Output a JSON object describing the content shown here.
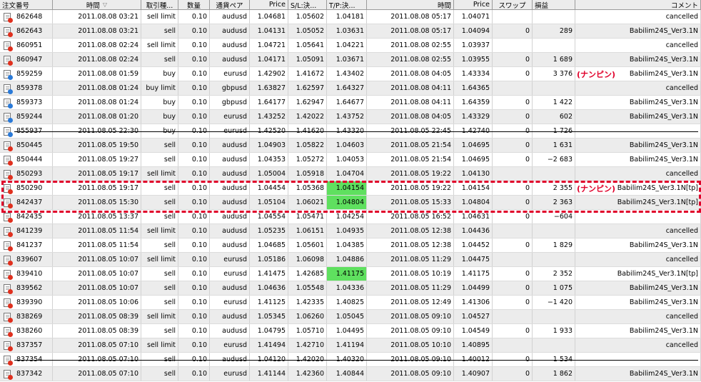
{
  "headers": {
    "order": "注文番号",
    "open_time": "時間",
    "type": "取引種...",
    "size": "数量",
    "symbol": "通貨ペア",
    "open_price": "Price",
    "sl": "S/L:決...",
    "tp": "T/P:決...",
    "close_time": "時間",
    "close_price": "Price",
    "swap": "スワップ",
    "profit": "損益",
    "comment": "コメント"
  },
  "sort_icon": "sort-down-arrow-icon",
  "highlight_color": "#5fe05f",
  "annotation_color": "#e0002a",
  "annotations": {
    "nanpin_1": "(ナンピン)",
    "nanpin_2": "(ナンピン)"
  },
  "rows": [
    {
      "order": "862648",
      "open_time": "2011.08.08 03:21",
      "type": "sell limit",
      "size": "0.10",
      "symbol": "audusd",
      "open_price": "1.04681",
      "sl": "1.05602",
      "tp": "1.04181",
      "close_time": "2011.08.08 05:17",
      "close_price": "1.04071",
      "swap": "",
      "profit": "",
      "comment": "cancelled",
      "icon": "red",
      "tp_hl": false,
      "strike": false
    },
    {
      "order": "862643",
      "open_time": "2011.08.08 03:21",
      "type": "sell",
      "size": "0.10",
      "symbol": "audusd",
      "open_price": "1.04131",
      "sl": "1.05052",
      "tp": "1.03631",
      "close_time": "2011.08.08 05:17",
      "close_price": "1.04094",
      "swap": "0",
      "profit": "289",
      "comment": "Babilim24S_Ver3.1N",
      "icon": "red",
      "tp_hl": false,
      "strike": false
    },
    {
      "order": "860951",
      "open_time": "2011.08.08 02:24",
      "type": "sell limit",
      "size": "0.10",
      "symbol": "audusd",
      "open_price": "1.04721",
      "sl": "1.05641",
      "tp": "1.04221",
      "close_time": "2011.08.08 02:55",
      "close_price": "1.03937",
      "swap": "",
      "profit": "",
      "comment": "cancelled",
      "icon": "red",
      "tp_hl": false,
      "strike": false
    },
    {
      "order": "860947",
      "open_time": "2011.08.08 02:24",
      "type": "sell",
      "size": "0.10",
      "symbol": "audusd",
      "open_price": "1.04171",
      "sl": "1.05091",
      "tp": "1.03671",
      "close_time": "2011.08.08 02:55",
      "close_price": "1.03955",
      "swap": "0",
      "profit": "1 689",
      "comment": "Babilim24S_Ver3.1N",
      "icon": "red",
      "tp_hl": false,
      "strike": false
    },
    {
      "order": "859259",
      "open_time": "2011.08.08 01:59",
      "type": "buy",
      "size": "0.10",
      "symbol": "eurusd",
      "open_price": "1.42902",
      "sl": "1.41672",
      "tp": "1.43402",
      "close_time": "2011.08.08 04:05",
      "close_price": "1.43334",
      "swap": "0",
      "profit": "3 376",
      "comment": "Babilim24S_Ver3.1N",
      "icon": "blue",
      "tp_hl": false,
      "strike": false
    },
    {
      "order": "859378",
      "open_time": "2011.08.08 01:24",
      "type": "buy limit",
      "size": "0.10",
      "symbol": "gbpusd",
      "open_price": "1.63827",
      "sl": "1.62597",
      "tp": "1.64327",
      "close_time": "2011.08.08 04:11",
      "close_price": "1.64365",
      "swap": "",
      "profit": "",
      "comment": "cancelled",
      "icon": "blue",
      "tp_hl": false,
      "strike": false
    },
    {
      "order": "859373",
      "open_time": "2011.08.08 01:24",
      "type": "buy",
      "size": "0.10",
      "symbol": "gbpusd",
      "open_price": "1.64177",
      "sl": "1.62947",
      "tp": "1.64677",
      "close_time": "2011.08.08 04:11",
      "close_price": "1.64359",
      "swap": "0",
      "profit": "1 422",
      "comment": "Babilim24S_Ver3.1N",
      "icon": "blue",
      "tp_hl": false,
      "strike": false
    },
    {
      "order": "859244",
      "open_time": "2011.08.08 01:20",
      "type": "buy",
      "size": "0.10",
      "symbol": "eurusd",
      "open_price": "1.43252",
      "sl": "1.42022",
      "tp": "1.43752",
      "close_time": "2011.08.08 04:05",
      "close_price": "1.43329",
      "swap": "0",
      "profit": "602",
      "comment": "Babilim24S_Ver3.1N",
      "icon": "blue",
      "tp_hl": false,
      "strike": false
    },
    {
      "order": "855937",
      "open_time": "2011.08.05 22:30",
      "type": "buy",
      "size": "0.10",
      "symbol": "eurusd",
      "open_price": "1.42520",
      "sl": "1.41620",
      "tp": "1.43320",
      "close_time": "2011.08.05 22:45",
      "close_price": "1.42740",
      "swap": "0",
      "profit": "1 726",
      "comment": "",
      "icon": "blue",
      "tp_hl": false,
      "strike": true
    },
    {
      "order": "850445",
      "open_time": "2011.08.05 19:50",
      "type": "sell",
      "size": "0.10",
      "symbol": "audusd",
      "open_price": "1.04903",
      "sl": "1.05822",
      "tp": "1.04603",
      "close_time": "2011.08.05 21:54",
      "close_price": "1.04695",
      "swap": "0",
      "profit": "1 631",
      "comment": "Babilim24S_Ver3.1N",
      "icon": "red",
      "tp_hl": false,
      "strike": false
    },
    {
      "order": "850444",
      "open_time": "2011.08.05 19:27",
      "type": "sell",
      "size": "0.10",
      "symbol": "audusd",
      "open_price": "1.04353",
      "sl": "1.05272",
      "tp": "1.04053",
      "close_time": "2011.08.05 21:54",
      "close_price": "1.04695",
      "swap": "0",
      "profit": "−2 683",
      "comment": "Babilim24S_Ver3.1N",
      "icon": "red",
      "tp_hl": false,
      "strike": false
    },
    {
      "order": "850293",
      "open_time": "2011.08.05 19:17",
      "type": "sell limit",
      "size": "0.10",
      "symbol": "audusd",
      "open_price": "1.05004",
      "sl": "1.05918",
      "tp": "1.04704",
      "close_time": "2011.08.05 19:22",
      "close_price": "1.04130",
      "swap": "",
      "profit": "",
      "comment": "cancelled",
      "icon": "red",
      "tp_hl": false,
      "strike": false
    },
    {
      "order": "850290",
      "open_time": "2011.08.05 19:17",
      "type": "sell",
      "size": "0.10",
      "symbol": "audusd",
      "open_price": "1.04454",
      "sl": "1.05368",
      "tp": "1.04154",
      "close_time": "2011.08.05 19:22",
      "close_price": "1.04154",
      "swap": "0",
      "profit": "2 355",
      "comment": "Babilim24S_Ver3.1N[tp]",
      "icon": "red",
      "tp_hl": true,
      "strike": false
    },
    {
      "order": "842437",
      "open_time": "2011.08.05 15:30",
      "type": "sell",
      "size": "0.10",
      "symbol": "audusd",
      "open_price": "1.05104",
      "sl": "1.06021",
      "tp": "1.04804",
      "close_time": "2011.08.05 15:33",
      "close_price": "1.04804",
      "swap": "0",
      "profit": "2 363",
      "comment": "Babilim24S_Ver3.1N[tp]",
      "icon": "red",
      "tp_hl": true,
      "strike": false
    },
    {
      "order": "842435",
      "open_time": "2011.08.05 13:37",
      "type": "sell",
      "size": "0.10",
      "symbol": "audusd",
      "open_price": "1.04554",
      "sl": "1.05471",
      "tp": "1.04254",
      "close_time": "2011.08.05 16:52",
      "close_price": "1.04631",
      "swap": "0",
      "profit": "−604",
      "comment": "",
      "icon": "red",
      "tp_hl": false,
      "strike": false
    },
    {
      "order": "841239",
      "open_time": "2011.08.05 11:54",
      "type": "sell limit",
      "size": "0.10",
      "symbol": "audusd",
      "open_price": "1.05235",
      "sl": "1.06151",
      "tp": "1.04935",
      "close_time": "2011.08.05 12:38",
      "close_price": "1.04436",
      "swap": "",
      "profit": "",
      "comment": "cancelled",
      "icon": "red",
      "tp_hl": false,
      "strike": false
    },
    {
      "order": "841237",
      "open_time": "2011.08.05 11:54",
      "type": "sell",
      "size": "0.10",
      "symbol": "audusd",
      "open_price": "1.04685",
      "sl": "1.05601",
      "tp": "1.04385",
      "close_time": "2011.08.05 12:38",
      "close_price": "1.04452",
      "swap": "0",
      "profit": "1 829",
      "comment": "Babilim24S_Ver3.1N",
      "icon": "red",
      "tp_hl": false,
      "strike": false
    },
    {
      "order": "839607",
      "open_time": "2011.08.05 10:07",
      "type": "sell limit",
      "size": "0.10",
      "symbol": "eurusd",
      "open_price": "1.05186",
      "sl": "1.06098",
      "tp": "1.04886",
      "close_time": "2011.08.05 11:29",
      "close_price": "1.04475",
      "swap": "",
      "profit": "",
      "comment": "cancelled",
      "icon": "red",
      "tp_hl": false,
      "strike": false
    },
    {
      "order": "839410",
      "open_time": "2011.08.05 10:07",
      "type": "sell",
      "size": "0.10",
      "symbol": "eurusd",
      "open_price": "1.41475",
      "sl": "1.42685",
      "tp": "1.41175",
      "close_time": "2011.08.05 10:19",
      "close_price": "1.41175",
      "swap": "0",
      "profit": "2 352",
      "comment": "Babilim24S_Ver3.1N[tp]",
      "icon": "red",
      "tp_hl": true,
      "strike": false
    },
    {
      "order": "839562",
      "open_time": "2011.08.05 10:07",
      "type": "sell",
      "size": "0.10",
      "symbol": "audusd",
      "open_price": "1.04636",
      "sl": "1.05548",
      "tp": "1.04336",
      "close_time": "2011.08.05 11:29",
      "close_price": "1.04499",
      "swap": "0",
      "profit": "1 075",
      "comment": "Babilim24S_Ver3.1N",
      "icon": "red",
      "tp_hl": false,
      "strike": false
    },
    {
      "order": "839390",
      "open_time": "2011.08.05 10:06",
      "type": "sell",
      "size": "0.10",
      "symbol": "eurusd",
      "open_price": "1.41125",
      "sl": "1.42335",
      "tp": "1.40825",
      "close_time": "2011.08.05 12:49",
      "close_price": "1.41306",
      "swap": "0",
      "profit": "−1 420",
      "comment": "Babilim24S_Ver3.1N",
      "icon": "red",
      "tp_hl": false,
      "strike": false
    },
    {
      "order": "838269",
      "open_time": "2011.08.05 08:39",
      "type": "sell limit",
      "size": "0.10",
      "symbol": "audusd",
      "open_price": "1.05345",
      "sl": "1.06260",
      "tp": "1.05045",
      "close_time": "2011.08.05 09:10",
      "close_price": "1.04527",
      "swap": "",
      "profit": "",
      "comment": "cancelled",
      "icon": "red",
      "tp_hl": false,
      "strike": false
    },
    {
      "order": "838260",
      "open_time": "2011.08.05 08:39",
      "type": "sell",
      "size": "0.10",
      "symbol": "audusd",
      "open_price": "1.04795",
      "sl": "1.05710",
      "tp": "1.04495",
      "close_time": "2011.08.05 09:10",
      "close_price": "1.04549",
      "swap": "0",
      "profit": "1 933",
      "comment": "Babilim24S_Ver3.1N",
      "icon": "red",
      "tp_hl": false,
      "strike": false
    },
    {
      "order": "837357",
      "open_time": "2011.08.05 07:10",
      "type": "sell limit",
      "size": "0.10",
      "symbol": "eurusd",
      "open_price": "1.41494",
      "sl": "1.42710",
      "tp": "1.41194",
      "close_time": "2011.08.05 10:10",
      "close_price": "1.40895",
      "swap": "",
      "profit": "",
      "comment": "cancelled",
      "icon": "red",
      "tp_hl": false,
      "strike": false
    },
    {
      "order": "837354",
      "open_time": "2011.08.05 07:10",
      "type": "sell",
      "size": "0.10",
      "symbol": "audusd",
      "open_price": "1.04120",
      "sl": "1.42020",
      "tp": "1.40320",
      "close_time": "2011.08.05 09:10",
      "close_price": "1.40012",
      "swap": "0",
      "profit": "1 534",
      "comment": "",
      "icon": "red",
      "tp_hl": false,
      "strike": true
    },
    {
      "order": "837342",
      "open_time": "2011.08.05 07:10",
      "type": "sell",
      "size": "0.10",
      "symbol": "eurusd",
      "open_price": "1.41144",
      "sl": "1.42360",
      "tp": "1.40844",
      "close_time": "2011.08.05 09:10",
      "close_price": "1.40907",
      "swap": "0",
      "profit": "1 862",
      "comment": "Babilim24S_Ver3.1N",
      "icon": "red",
      "tp_hl": false,
      "strike": false
    }
  ]
}
